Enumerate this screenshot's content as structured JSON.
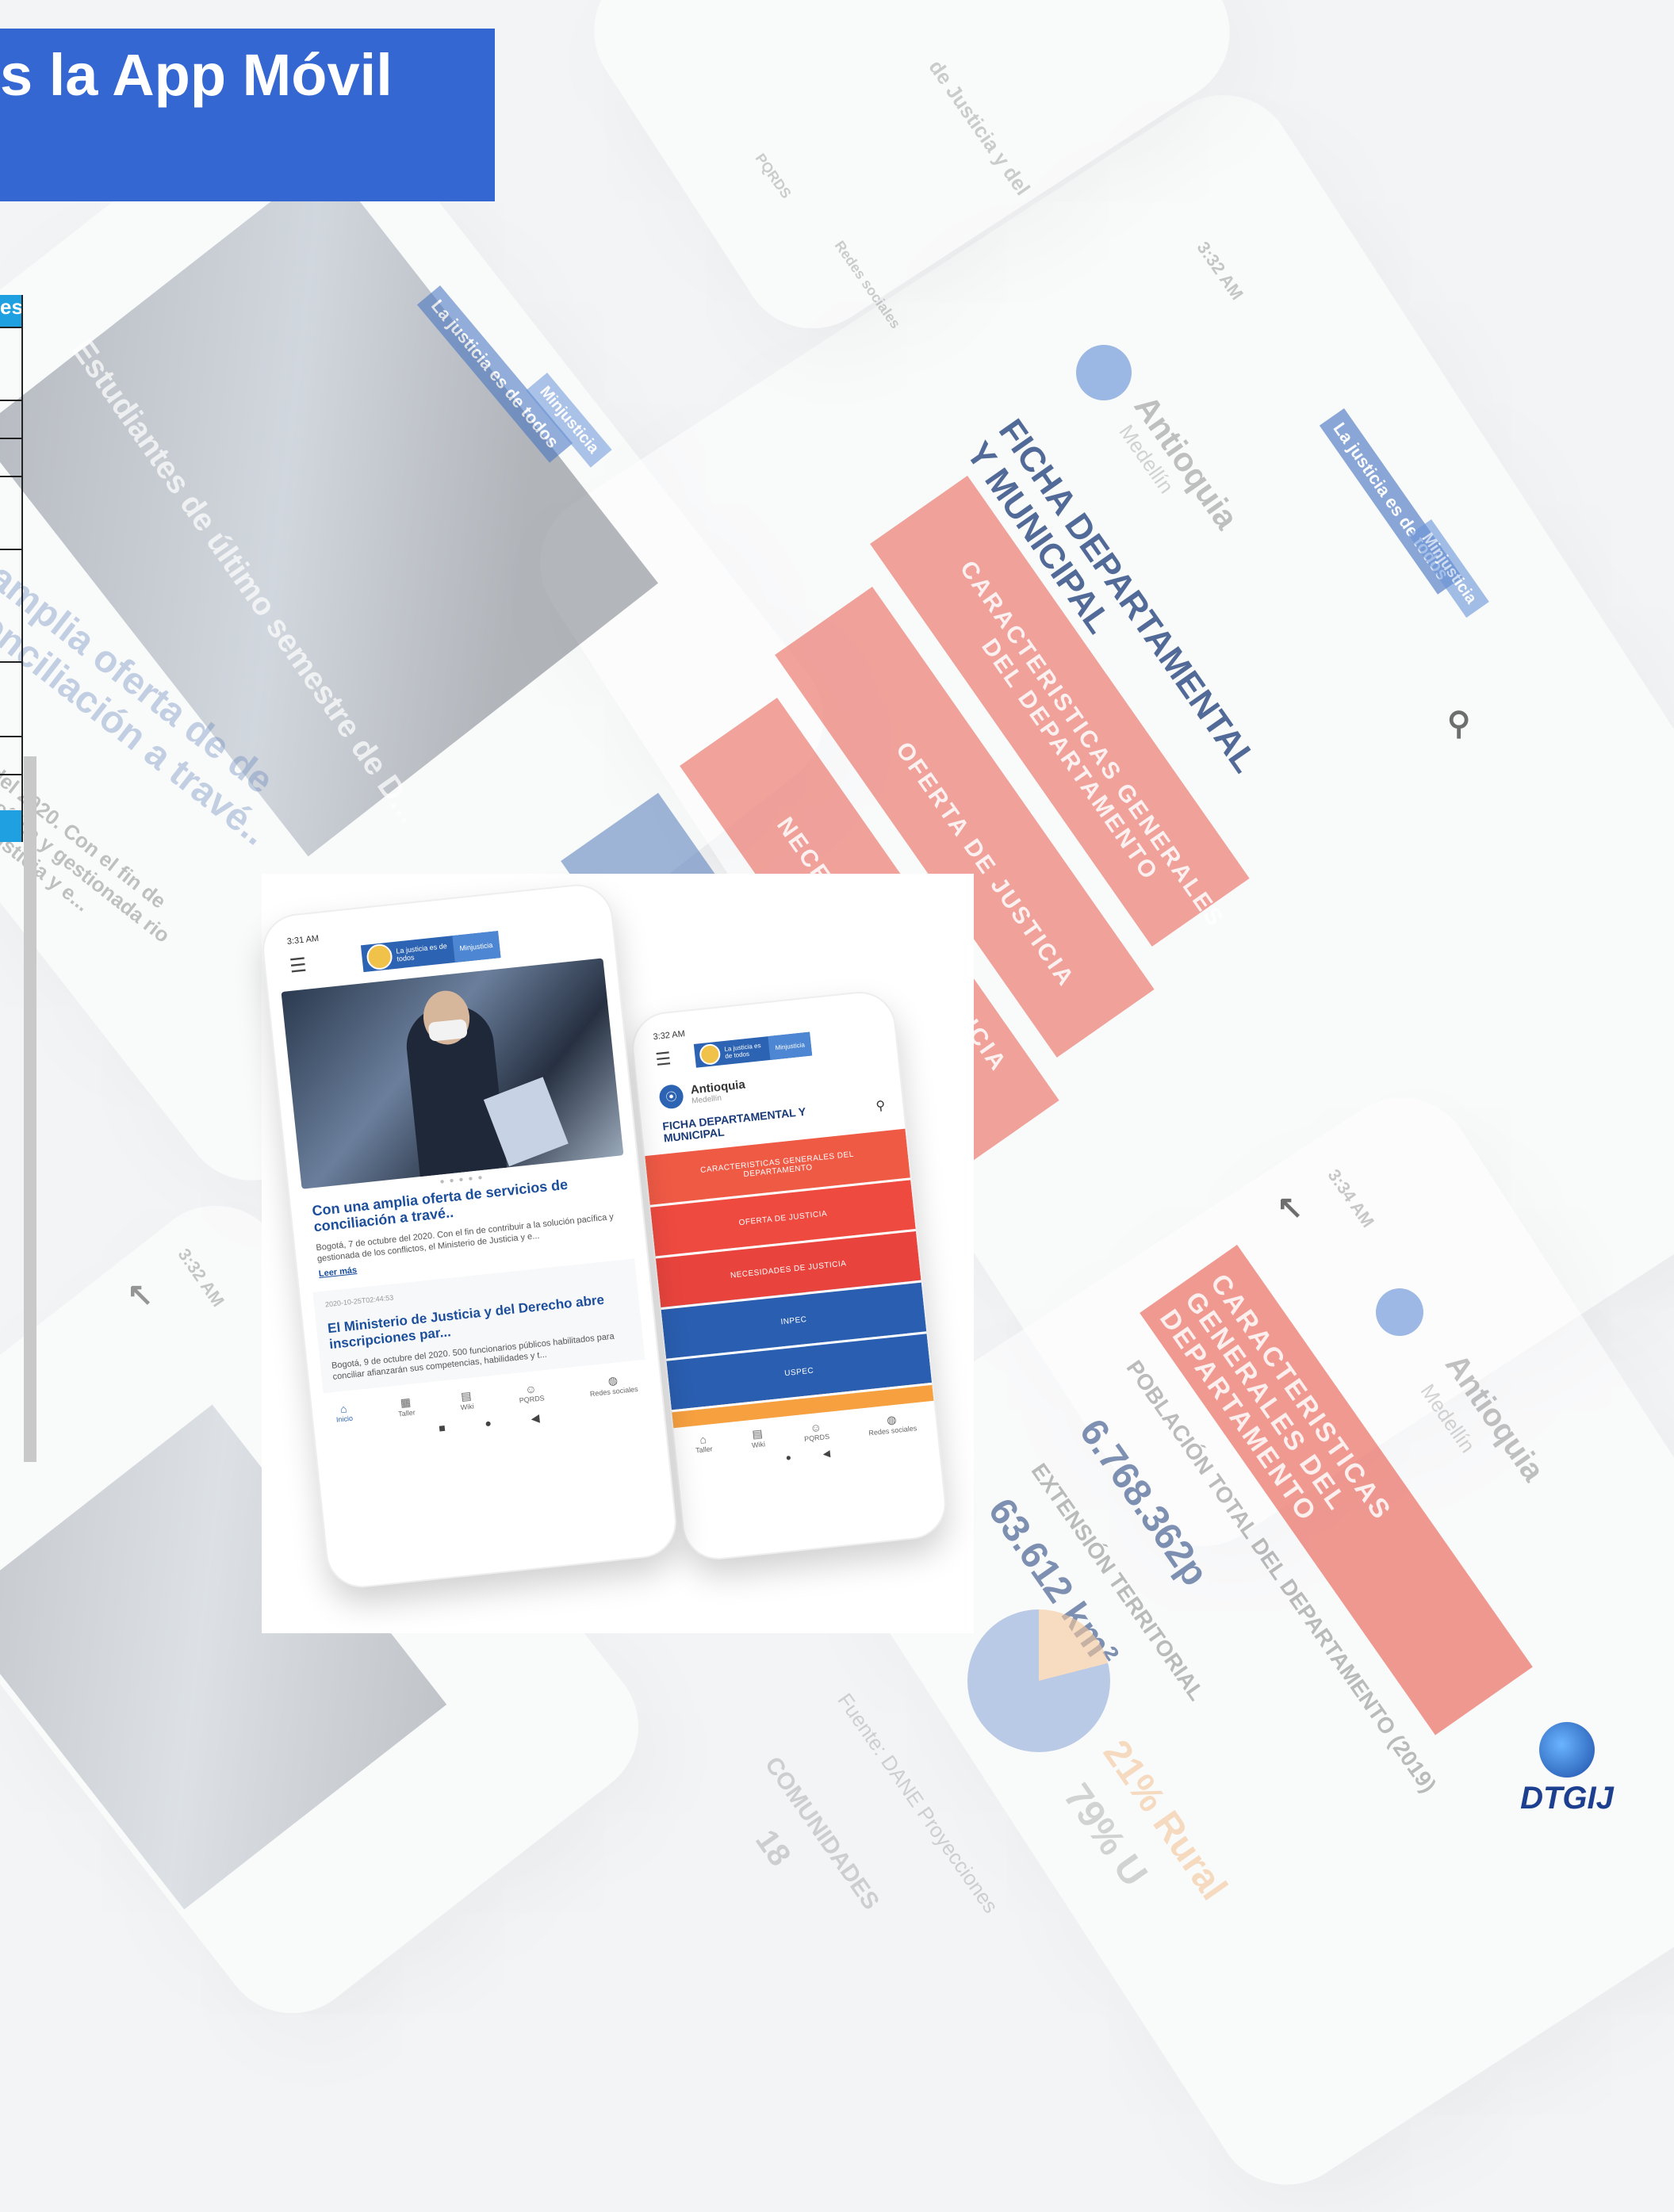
{
  "title": "s la App Móvil",
  "table_fragment": {
    "header": "es"
  },
  "background": {
    "phone_left_caption": "Estudiantes de último semestre de D...",
    "phone_left_title": "amplia oferta de de conciliación a travé..",
    "phone_left_body": "del 2020. Con el fin de pacífica y gestionada rio de Justicia y e...",
    "phone_left_logo_left": "La justicia es de todos",
    "phone_left_logo_right": "Minjusticia",
    "top_right_items": [
      "PQRDS",
      "Redes sociales",
      "de Justicia y del"
    ],
    "right_phone_time": "3:32 AM",
    "right_phone_region": "Antioquia",
    "right_phone_city": "Medellín",
    "right_phone_heading": "FICHA DEPARTAMENTAL Y MUNICIPAL",
    "right_phone_buttons": [
      "CARACTERISTICAS GENERALES DEL DEPARTAMENTO",
      "OFERTA DE JUSTICIA",
      "NECES",
      "ICIA"
    ],
    "right_phone_logo_left": "La justicia es de todos",
    "right_phone_logo_right": "Minjusticia",
    "bottom_phone_time": "3:34 AM",
    "bottom_phone_region": "Antioquia",
    "bottom_phone_city": "Medellín",
    "bottom_phone_banner": "CARACTERISTICAS GENERALES DEL DEPARTAMENTO",
    "bottom_phone_stat1_label": "POBLACIÓN TOTAL DEL DEPARTAMENTO (2019)",
    "bottom_phone_stat1_value": "6.768.362p",
    "bottom_phone_stat2_label": "EXTENSIÓN TERRITORIAL",
    "bottom_phone_stat2_value": "63.612 km²",
    "bottom_phone_rural": "21% Rural",
    "bottom_phone_urban": "79% U",
    "bottom_phone_source": "Fuente: DANE Proyecciones",
    "bottom_phone_comunidades": "COMUNIDADES",
    "bottom_phone_count": "18",
    "bottom_left_time": "3:32 AM"
  },
  "phone_main": {
    "time": "3:31 AM",
    "logo_left": "La justicia es de todos",
    "logo_right": "Minjusticia",
    "news1_title": "Con una amplia oferta de servicios de conciliación a travé..",
    "news1_body": "Bogotá, 7 de octubre del 2020. Con el fin de contribuir a la solución pacífica y gestionada de los conflictos, el Ministerio de Justicia y e...",
    "news1_link": "Leer más",
    "news2_date": "2020-10-25T02:44:53",
    "news2_title": "El Ministerio de Justicia y del Derecho abre inscripciones par...",
    "news2_body": "Bogotá, 9 de octubre del 2020. 500 funcionarios públicos habilitados para conciliar afianzarán sus competencias, habilidades y t...",
    "nav": [
      "Inicio",
      "Taller",
      "Wiki",
      "PQRDS",
      "Redes sociales"
    ]
  },
  "phone_second": {
    "time": "3:32 AM",
    "logo_left": "La justicia es de todos",
    "logo_right": "Minjusticia",
    "region": "Antioquia",
    "city": "Medellín",
    "heading": "FICHA DEPARTAMENTAL Y MUNICIPAL",
    "buttons": [
      {
        "label": "CARACTERISTICAS GENERALES DEL DEPARTAMENTO",
        "color": "#ef5a45"
      },
      {
        "label": "OFERTA DE JUSTICIA",
        "color": "#ee4a40"
      },
      {
        "label": "NECESIDADES DE JUSTICIA",
        "color": "#e8443d"
      },
      {
        "label": "INPEC",
        "color": "#2a5eb0"
      },
      {
        "label": "USPEC",
        "color": "#2a5eb0"
      },
      {
        "label": "",
        "color": "#f6a040"
      }
    ],
    "nav": [
      "Taller",
      "Wiki",
      "PQRDS",
      "Redes sociales"
    ]
  },
  "logo_text": "DTGIJ",
  "colors": {
    "banner": "#3567d3",
    "accent_blue": "#2d63b3",
    "accent_red": "#e8574a",
    "table_header": "#1fa0e0"
  }
}
